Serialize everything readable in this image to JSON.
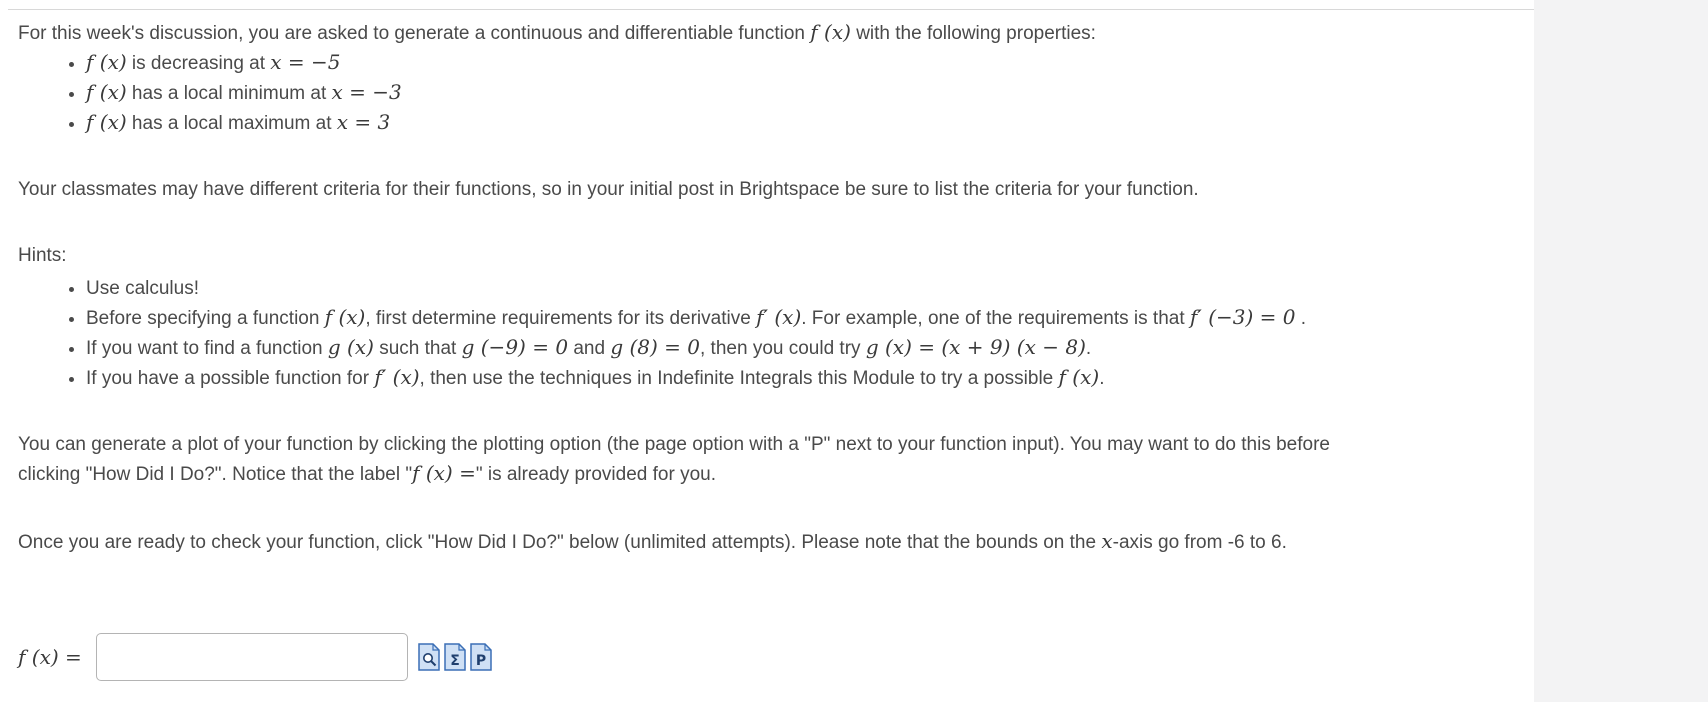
{
  "intro": {
    "before": "For this week's discussion, you are asked to generate a continuous and differentiable function ",
    "fx": "f (x)",
    "after": " with the following properties:"
  },
  "properties": [
    {
      "fx": "f (x)",
      "text": " is decreasing at ",
      "math": "x = −5"
    },
    {
      "fx": "f (x)",
      "text": " has a local minimum at ",
      "math": "x = −3"
    },
    {
      "fx": "f (x)",
      "text": " has a local maximum at ",
      "math": "x = 3"
    }
  ],
  "classmates_note": "Your classmates may have different criteria for their functions, so in your initial post in Brightspace be sure to list the criteria for your function.",
  "hints_heading": "Hints:",
  "hints": {
    "h1": "Use calculus!",
    "h2": {
      "a": "Before specifying a function ",
      "fx": "f (x)",
      "b": ", first determine requirements for its derivative ",
      "fpx": "f′ (x)",
      "c": ". For example, one of the requirements is that ",
      "req": "f′ (−3) = 0",
      "d": " ."
    },
    "h3": {
      "a": "If you want to find a function ",
      "gx": "g (x)",
      "b": " such that ",
      "g1": "g (−9) = 0",
      "c": " and ",
      "g2": "g (8) = 0",
      "d": ", then you could try  ",
      "gform": "g (x) = (x + 9) (x − 8)",
      "e": "."
    },
    "h4": {
      "a": "If you have a possible function for ",
      "fpx": "f′ (x)",
      "b": ", then use the techniques in Indefinite Integrals this Module to try a possible ",
      "fx": "f (x)",
      "c": "."
    }
  },
  "plot_note": {
    "line1": "You can generate a plot of your function by clicking the plotting option (the page option with a \"P\" next to your function input). You may want to do this before",
    "line2a": "clicking \"How Did I Do?\". Notice that the label \"",
    "line2math": "f (x) =",
    "line2b": "\" is already provided for you."
  },
  "check_note": {
    "a": "Once you are ready to check your function, click \"How Did I Do?\" below (unlimited attempts). Please note that the bounds on the ",
    "x": "x",
    "b": "-axis go from -6 to 6."
  },
  "answer": {
    "label": "f (x) =",
    "value": "",
    "placeholder": ""
  },
  "tools": [
    {
      "name": "preview-icon",
      "glyph": ""
    },
    {
      "name": "equation-editor-icon",
      "glyph": "Σ"
    },
    {
      "name": "plot-icon",
      "glyph": "P"
    }
  ],
  "colors": {
    "text": "#4a4a4a",
    "gutter": "#f3f3f4",
    "icon_blue": "#3b6fb6",
    "icon_fill": "#cfe0f5"
  }
}
